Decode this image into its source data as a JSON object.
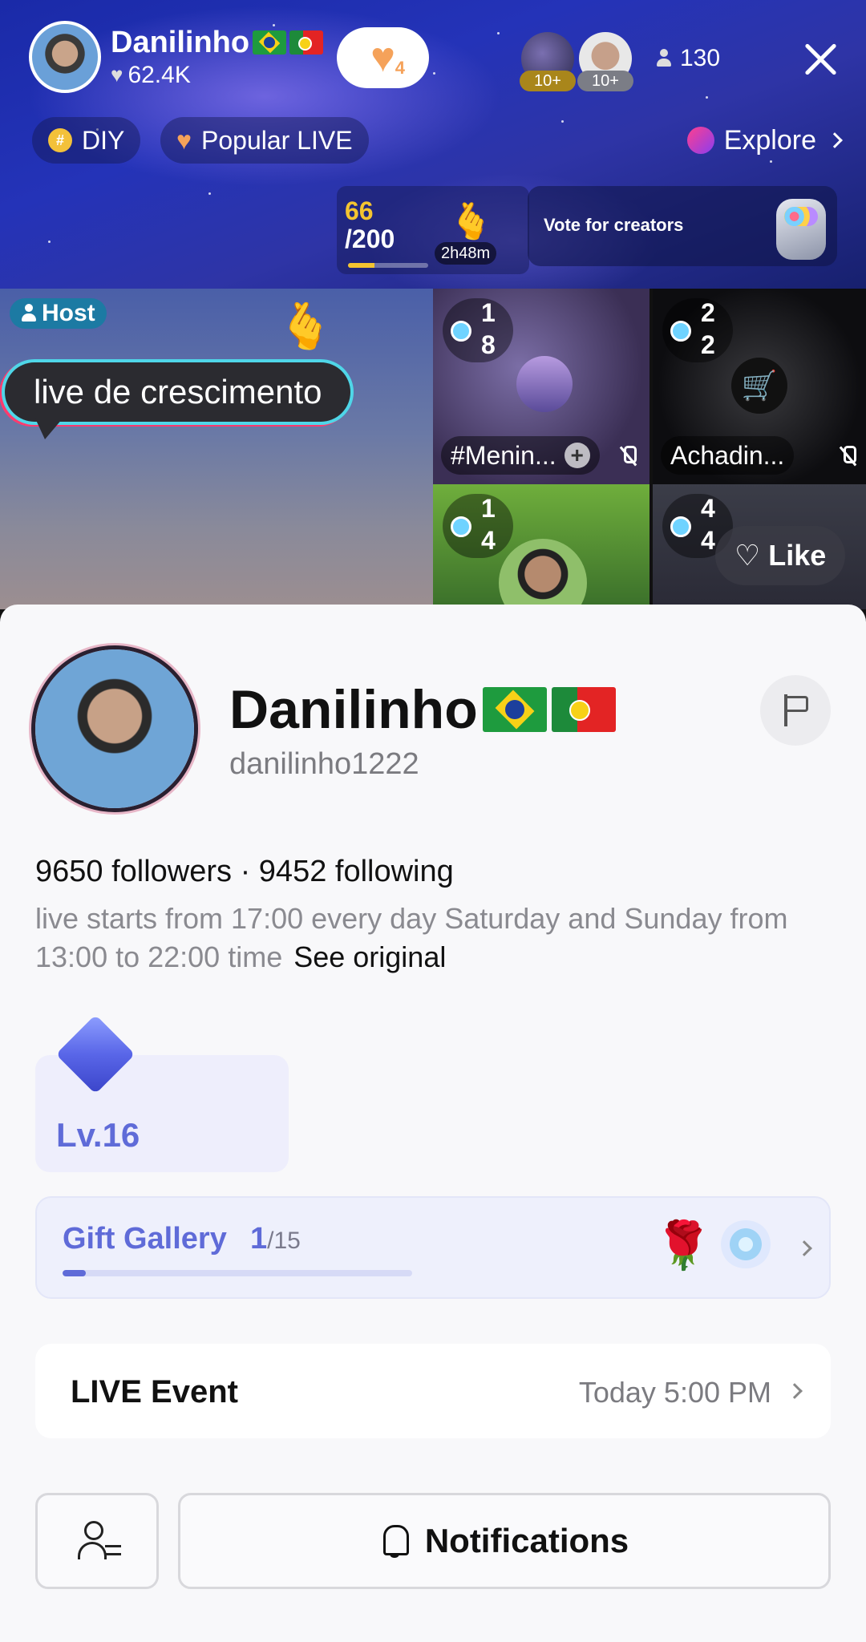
{
  "header": {
    "host_name": "Danilinho",
    "host_likes": "62.4K",
    "like_count": "4",
    "viewer_tags": [
      "10+",
      "10+"
    ],
    "viewer_count": "130"
  },
  "chips": {
    "diy": "DIY",
    "popular": "Popular LIVE",
    "explore": "Explore"
  },
  "goal": {
    "current": "66",
    "total": "/200",
    "progress": 0.33,
    "timer": "2h48m",
    "vote_label": "Vote for creators"
  },
  "stream": {
    "host_tag": "Host",
    "speech_bubble": "live de crescimento",
    "cells": [
      {
        "rank_top": "1",
        "rank_bottom": "8",
        "label": "#Menin..."
      },
      {
        "rank_top": "2",
        "rank_bottom": "2",
        "label": "Achadin..."
      },
      {
        "rank_top": "1",
        "rank_bottom": "4"
      },
      {
        "rank_top": "4",
        "rank_bottom": "4"
      }
    ],
    "like_button": "Like"
  },
  "profile": {
    "name": "Danilinho",
    "handle": "danilinho1222",
    "follows_line": "9650 followers · 9452 following",
    "bio": "live starts from 17:00 every day Saturday and Sunday from 13:00 to 22:00 time",
    "see_original": "See original",
    "level": "Lv.16"
  },
  "gift_gallery": {
    "title": "Gift Gallery",
    "collected": "1",
    "total": "/15",
    "progress": 0.067
  },
  "live_event": {
    "title": "LIVE Event",
    "time": "Today 5:00 PM"
  },
  "actions": {
    "notifications": "Notifications"
  },
  "colors": {
    "accent": "#5f6bd8",
    "goal_gold": "#f4c430",
    "host_tag": "#1c7aa3"
  }
}
